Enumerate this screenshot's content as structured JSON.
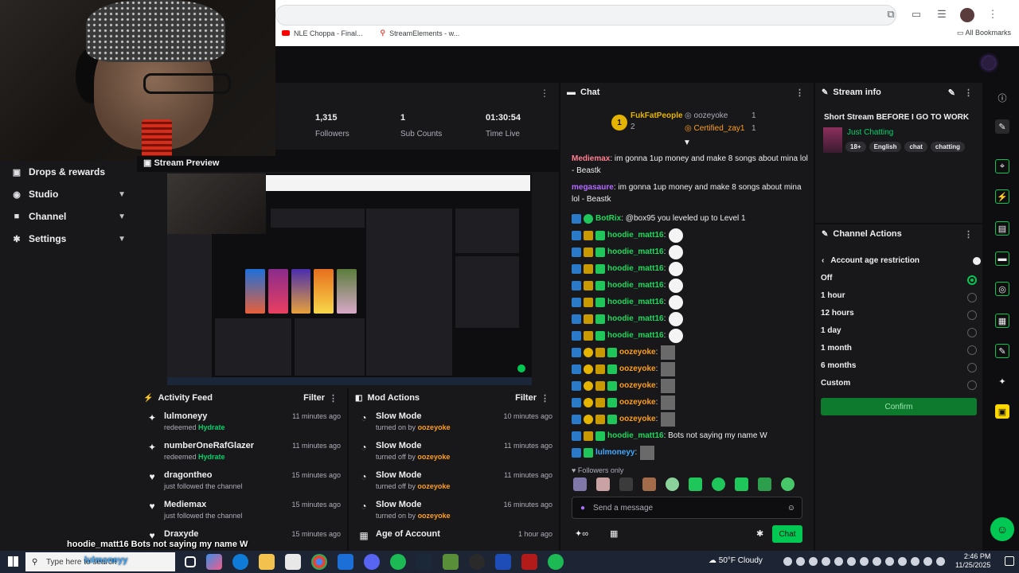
{
  "browser": {
    "bookmarks": [
      "NLE Choppa - Final...",
      "StreamElements - w..."
    ],
    "all_bookmarks": "All Bookmarks"
  },
  "sidebar": {
    "items": [
      {
        "label": "Drops & rewards",
        "icon": "gift-icon"
      },
      {
        "label": "Studio",
        "icon": "studio-icon"
      },
      {
        "label": "Channel",
        "icon": "channel-icon"
      },
      {
        "label": "Settings",
        "icon": "gear-icon"
      }
    ]
  },
  "stats": {
    "followers_value": "1,315",
    "followers_label": "Followers",
    "subs_value": "1",
    "subs_label": "Sub Counts",
    "time_value": "01:30:54",
    "time_label": "Time Live"
  },
  "preview": {
    "title": "Stream Preview"
  },
  "activity": {
    "title": "Activity Feed",
    "filter": "Filter",
    "items": [
      {
        "name": "lulmoneyy",
        "desc": "redeemed",
        "reward": "Hydrate",
        "time": "11 minutes ago"
      },
      {
        "name": "numberOneRafGlazer",
        "desc": "redeemed",
        "reward": "Hydrate",
        "time": "11 minutes ago"
      },
      {
        "name": "dragontheo",
        "desc": "just followed the channel",
        "reward": "",
        "time": "15 minutes ago"
      },
      {
        "name": "Mediemax",
        "desc": "just followed the channel",
        "reward": "",
        "time": "15 minutes ago"
      },
      {
        "name": "Draxyde",
        "desc": "",
        "reward": "",
        "time": "15 minutes ago"
      }
    ]
  },
  "mod_actions": {
    "title": "Mod Actions",
    "filter": "Filter",
    "items": [
      {
        "name": "Slow Mode",
        "desc": "turned on by",
        "by": "oozeyoke",
        "time": "10 minutes ago"
      },
      {
        "name": "Slow Mode",
        "desc": "turned off by",
        "by": "oozeyoke",
        "time": "11 minutes ago"
      },
      {
        "name": "Slow Mode",
        "desc": "turned off by",
        "by": "oozeyoke",
        "time": "11 minutes ago"
      },
      {
        "name": "Slow Mode",
        "desc": "turned on by",
        "by": "oozeyoke",
        "time": "16 minutes ago"
      },
      {
        "name": "Age of Account",
        "desc": "",
        "by": "",
        "time": "1 hour ago"
      }
    ]
  },
  "chat": {
    "title": "Chat",
    "leaderboard": {
      "first_name": "FukFatPeople",
      "first_rank": "1",
      "first_count": "2",
      "second_name": "oozeyoke",
      "second_count": "1",
      "third_name": "Certified_zay1",
      "third_count": "1"
    },
    "messages": [
      {
        "user": "Mediemax",
        "color": "#ff7f8f",
        "text": ": im gonna 1up money and make 8 songs about mina lol - Beastk"
      },
      {
        "user": "megasaure",
        "color": "#b36bff",
        "text": ": im gonna 1up money and make 8 songs about mina lol - Beastk"
      }
    ],
    "bot_user": "BotRix",
    "bot_text": ": @box95 you leveled up to Level 1",
    "rows": [
      {
        "user": "hoodie_matt16",
        "color": "#1fd85c",
        "text": ":",
        "type": "hoodie",
        "emote": "ghost"
      },
      {
        "user": "hoodie_matt16",
        "color": "#1fd85c",
        "text": ":",
        "type": "hoodie",
        "emote": "ghost"
      },
      {
        "user": "hoodie_matt16",
        "color": "#1fd85c",
        "text": ":",
        "type": "hoodie",
        "emote": "ghost"
      },
      {
        "user": "hoodie_matt16",
        "color": "#1fd85c",
        "text": ":",
        "type": "hoodie",
        "emote": "ghost"
      },
      {
        "user": "hoodie_matt16",
        "color": "#1fd85c",
        "text": ":",
        "type": "hoodie",
        "emote": "ghost"
      },
      {
        "user": "hoodie_matt16",
        "color": "#1fd85c",
        "text": ":",
        "type": "hoodie",
        "emote": "ghost"
      },
      {
        "user": "hoodie_matt16",
        "color": "#1fd85c",
        "text": ":",
        "type": "hoodie",
        "emote": "ghost"
      },
      {
        "user": "oozeyoke",
        "color": "#ff9f1a",
        "text": ":",
        "type": "ooze",
        "emote": "face"
      },
      {
        "user": "oozeyoke",
        "color": "#ff9f1a",
        "text": ":",
        "type": "ooze",
        "emote": "face"
      },
      {
        "user": "oozeyoke",
        "color": "#ff9f1a",
        "text": ":",
        "type": "ooze",
        "emote": "face"
      },
      {
        "user": "oozeyoke",
        "color": "#ff9f1a",
        "text": ":",
        "type": "ooze",
        "emote": "face"
      },
      {
        "user": "oozeyoke",
        "color": "#ff9f1a",
        "text": ":",
        "type": "ooze",
        "emote": "face"
      },
      {
        "user": "hoodie_matt16",
        "color": "#1fd85c",
        "text": ": Bots not saying my name W",
        "type": "hoodie",
        "emote": ""
      },
      {
        "user": "lulmoneyy",
        "color": "#3fa9ff",
        "text": ":",
        "type": "lul",
        "emote": "face"
      }
    ],
    "followers_only": "Followers only",
    "input_placeholder": "Send a message",
    "send_button": "Chat"
  },
  "stream_info": {
    "title": "Stream info",
    "stream_title": "Short Stream BEFORE I GO TO WORK",
    "category": "Just Chatting",
    "tags": [
      "18+",
      "English",
      "chat",
      "chatting"
    ]
  },
  "channel_actions": {
    "title": "Channel Actions",
    "subtitle": "Account age restriction",
    "options": [
      "Off",
      "1 hour",
      "12 hours",
      "1 day",
      "1 month",
      "6 months",
      "Custom"
    ],
    "selected": "Off",
    "confirm": "Confirm"
  },
  "overlay_text": "hoodie_matt16  Bots not saying my name W",
  "taskbar": {
    "search_placeholder": "Type here to search",
    "search_overlay": "lulmoneyy",
    "weather": "50°F  Cloudy",
    "time": "2:46 PM",
    "date": "11/25/2025"
  },
  "colors": {
    "accent_green": "#00c853",
    "bg_dark": "#0e0e10",
    "panel": "#18181b"
  }
}
